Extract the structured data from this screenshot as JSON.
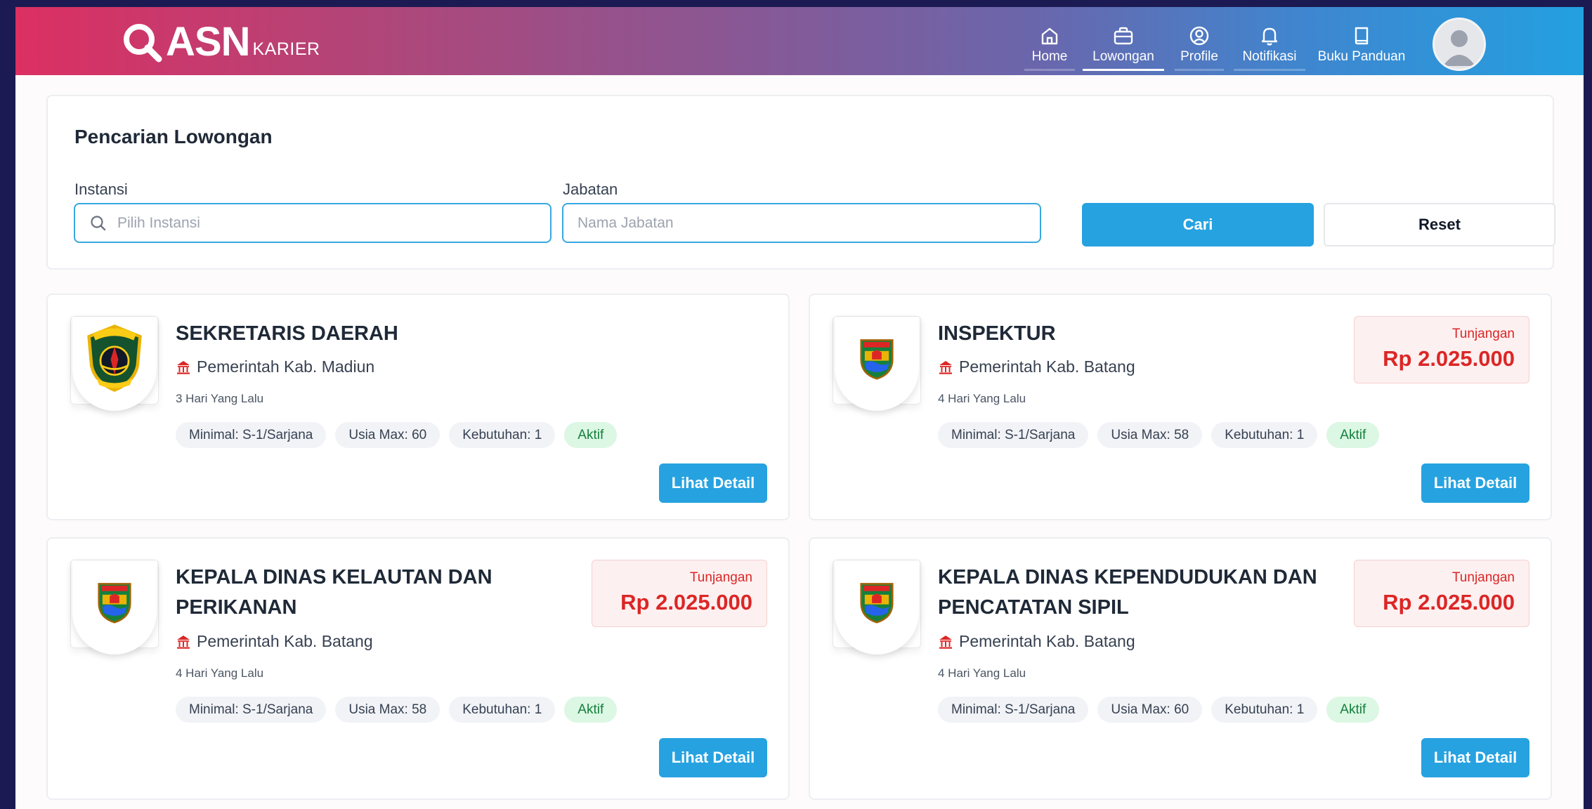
{
  "brand": {
    "logo_main": "ASN",
    "logo_sub": "KARIER"
  },
  "nav": [
    {
      "label": "Home",
      "icon": "home-icon"
    },
    {
      "label": "Lowongan",
      "icon": "briefcase-icon",
      "active": true
    },
    {
      "label": "Profile",
      "icon": "user-circle-icon"
    },
    {
      "label": "Notifikasi",
      "icon": "bell-icon"
    },
    {
      "label": "Buku Panduan",
      "icon": "book-icon"
    }
  ],
  "search": {
    "title": "Pencarian Lowongan",
    "instansi_label": "Instansi",
    "instansi_placeholder": "Pilih Instansi",
    "jabatan_label": "Jabatan",
    "jabatan_placeholder": "Nama Jabatan",
    "cari_label": "Cari",
    "reset_label": "Reset"
  },
  "jobs": [
    {
      "title_line1": "SEKRETARIS DAERAH",
      "title_line2": "",
      "institution": "Pemerintah Kab. Madiun",
      "posted": "3 Hari Yang Lalu",
      "tags": [
        "Minimal: S-1/Sarjana",
        "Usia Max: 60",
        "Kebutuhan: 1"
      ],
      "status": "Aktif",
      "allowance_label": "",
      "allowance_amount": "",
      "detail_label": "Lihat Detail",
      "seal": "madiun"
    },
    {
      "title_line1": "INSPEKTUR",
      "title_line2": "",
      "institution": "Pemerintah Kab. Batang",
      "posted": "4 Hari Yang Lalu",
      "tags": [
        "Minimal: S-1/Sarjana",
        "Usia Max: 58",
        "Kebutuhan: 1"
      ],
      "status": "Aktif",
      "allowance_label": "Tunjangan",
      "allowance_amount": "Rp 2.025.000",
      "detail_label": "Lihat Detail",
      "seal": "batang"
    },
    {
      "title_line1": "KEPALA DINAS KELAUTAN DAN",
      "title_line2": "PERIKANAN",
      "institution": "Pemerintah Kab. Batang",
      "posted": "4 Hari Yang Lalu",
      "tags": [
        "Minimal: S-1/Sarjana",
        "Usia Max: 58",
        "Kebutuhan: 1"
      ],
      "status": "Aktif",
      "allowance_label": "Tunjangan",
      "allowance_amount": "Rp 2.025.000",
      "detail_label": "Lihat Detail",
      "seal": "batang"
    },
    {
      "title_line1": "KEPALA DINAS KEPENDUDUKAN DAN",
      "title_line2": "PENCATATAN SIPIL",
      "institution": "Pemerintah Kab. Batang",
      "posted": "4 Hari Yang Lalu",
      "tags": [
        "Minimal: S-1/Sarjana",
        "Usia Max: 60",
        "Kebutuhan: 1"
      ],
      "status": "Aktif",
      "allowance_label": "Tunjangan",
      "allowance_amount": "Rp 2.025.000",
      "detail_label": "Lihat Detail",
      "seal": "batang"
    }
  ],
  "colors": {
    "primary": "#26a2e0",
    "danger": "#dc2626",
    "aktif_bg": "#dcf7e4",
    "aktif_text": "#15803d"
  }
}
